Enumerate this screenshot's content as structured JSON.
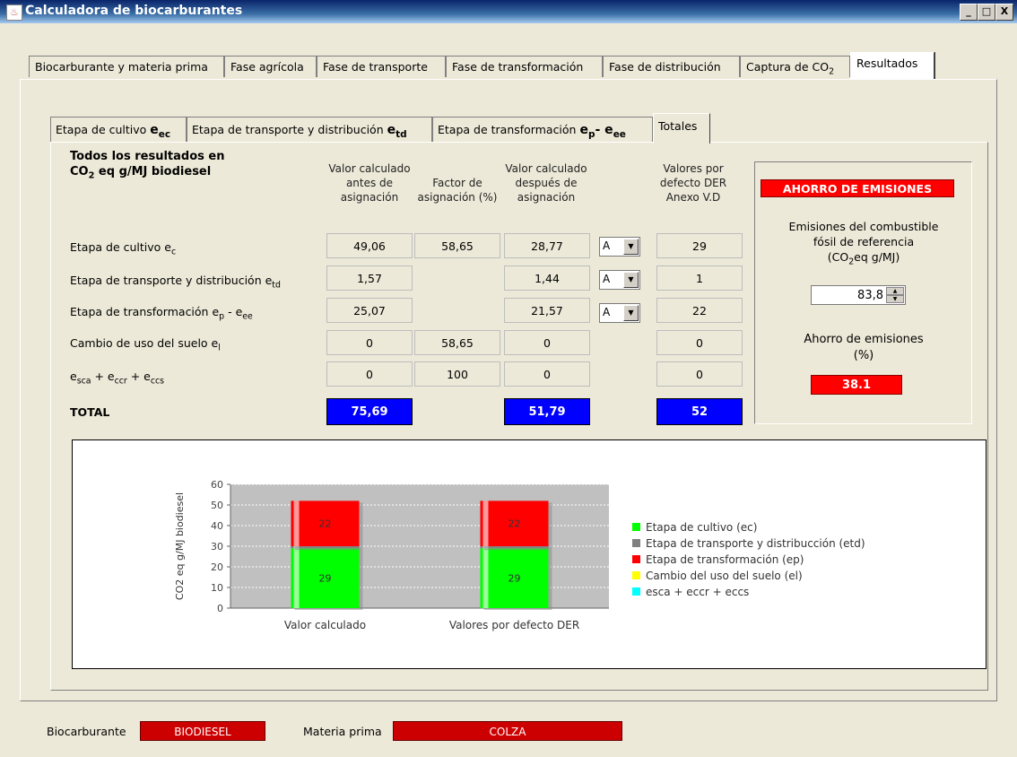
{
  "window": {
    "title": "Calculadora de biocarburantes",
    "minimize": "_",
    "maximize": "□",
    "close": "X"
  },
  "main_tabs": [
    "Biocarburante y materia prima",
    "Fase agrícola",
    "Fase de transporte",
    "Fase de transformación",
    "Fase de distribución",
    "Captura de CO2",
    "Resultados"
  ],
  "sub_tabs": [
    "Etapa de cultivo eec",
    "Etapa de transporte y distribución etd",
    "Etapa de transformación ep- eee",
    "Totales"
  ],
  "table": {
    "heading_line1": "Todos los resultados en",
    "heading_line2": "CO2 eq g/MJ biodiesel",
    "col_headers": [
      "Valor calculado antes de asignación",
      "Factor de asignación (%)",
      "Valor calculado después de asignación",
      "Valores por defecto DER Anexo V.D"
    ],
    "rows": [
      {
        "label": "Etapa de cultivo ec",
        "before": "49,06",
        "factor": "58,65",
        "after": "28,77",
        "combo": "A",
        "default": "29"
      },
      {
        "label": "Etapa de transporte y distribución etd",
        "before": "1,57",
        "factor": "",
        "after": "1,44",
        "combo": "A",
        "default": "1"
      },
      {
        "label": "Etapa de transformación ep - eee",
        "before": "25,07",
        "factor": "",
        "after": "21,57",
        "combo": "A",
        "default": "22"
      },
      {
        "label": "Cambio de uso del suelo el",
        "before": "0",
        "factor": "58,65",
        "after": "0",
        "combo": "",
        "default": "0"
      },
      {
        "label": "esca + eccr + eccs",
        "before": "0",
        "factor": "100",
        "after": "0",
        "combo": "",
        "default": "0"
      }
    ],
    "total_label": "TOTAL",
    "total_before": "75,69",
    "total_after": "51,79",
    "total_default": "52"
  },
  "savings": {
    "title": "AHORRO DE EMISIONES",
    "ref_label_1": "Emisiones del combustible",
    "ref_label_2": "fósil de referencia",
    "ref_label_3": "(CO2eq g/MJ)",
    "ref_value": "83,8",
    "savings_label_1": "Ahorro de emisiones",
    "savings_label_2": "(%)",
    "savings_value": "38.1"
  },
  "chart_data": {
    "type": "bar",
    "stacked": true,
    "categories": [
      "Valor calculado",
      "Valores por defecto DER"
    ],
    "series": [
      {
        "name": "Etapa de cultivo (ec)",
        "color": "#00ff00",
        "values": [
          29,
          29
        ]
      },
      {
        "name": "Etapa de transporte y distribucción (etd)",
        "color": "#808080",
        "values": [
          1,
          1
        ]
      },
      {
        "name": "Etapa de transformación (ep)",
        "color": "#ff0000",
        "values": [
          22,
          22
        ]
      },
      {
        "name": "Cambio del uso del suelo (el)",
        "color": "#ffff00",
        "values": [
          0,
          0
        ]
      },
      {
        "name": "esca + eccr + eccs",
        "color": "#00ffff",
        "values": [
          0,
          0
        ]
      }
    ],
    "data_labels": [
      "29",
      "22",
      "29",
      "22"
    ],
    "ylabel": "CO2 eq g/MJ biodiesel",
    "yticks": [
      "0",
      "10",
      "20",
      "30",
      "40",
      "50",
      "60"
    ],
    "ylim": [
      0,
      60
    ],
    "legend_position": "right"
  },
  "footer": {
    "biocarb_label": "Biocarburante",
    "biocarb_value": "BIODIESEL",
    "materia_label": "Materia prima",
    "materia_value": "COLZA"
  }
}
